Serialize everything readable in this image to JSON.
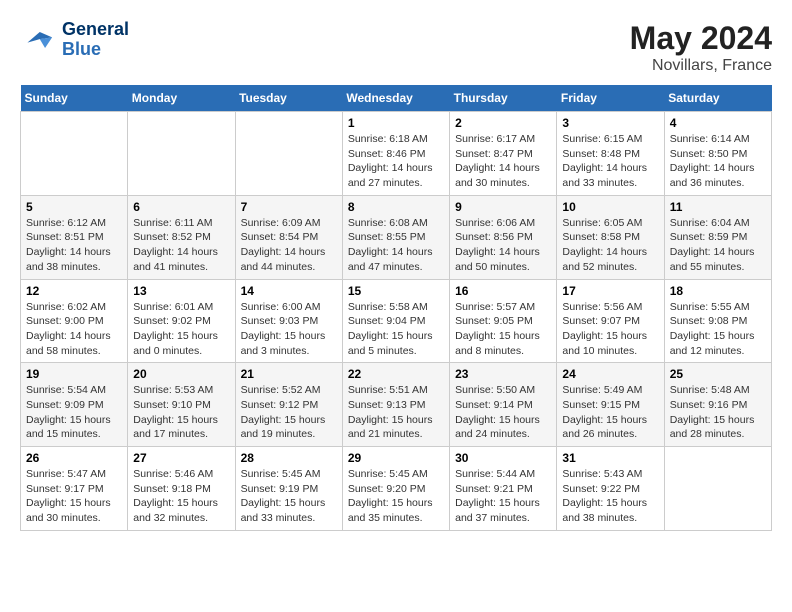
{
  "logo": {
    "text_general": "General",
    "text_blue": "Blue"
  },
  "title": "May 2024",
  "subtitle": "Novillars, France",
  "days_header": [
    "Sunday",
    "Monday",
    "Tuesday",
    "Wednesday",
    "Thursday",
    "Friday",
    "Saturday"
  ],
  "weeks": [
    [
      {
        "day": "",
        "info": ""
      },
      {
        "day": "",
        "info": ""
      },
      {
        "day": "",
        "info": ""
      },
      {
        "day": "1",
        "info": "Sunrise: 6:18 AM\nSunset: 8:46 PM\nDaylight: 14 hours and 27 minutes."
      },
      {
        "day": "2",
        "info": "Sunrise: 6:17 AM\nSunset: 8:47 PM\nDaylight: 14 hours and 30 minutes."
      },
      {
        "day": "3",
        "info": "Sunrise: 6:15 AM\nSunset: 8:48 PM\nDaylight: 14 hours and 33 minutes."
      },
      {
        "day": "4",
        "info": "Sunrise: 6:14 AM\nSunset: 8:50 PM\nDaylight: 14 hours and 36 minutes."
      }
    ],
    [
      {
        "day": "5",
        "info": "Sunrise: 6:12 AM\nSunset: 8:51 PM\nDaylight: 14 hours and 38 minutes."
      },
      {
        "day": "6",
        "info": "Sunrise: 6:11 AM\nSunset: 8:52 PM\nDaylight: 14 hours and 41 minutes."
      },
      {
        "day": "7",
        "info": "Sunrise: 6:09 AM\nSunset: 8:54 PM\nDaylight: 14 hours and 44 minutes."
      },
      {
        "day": "8",
        "info": "Sunrise: 6:08 AM\nSunset: 8:55 PM\nDaylight: 14 hours and 47 minutes."
      },
      {
        "day": "9",
        "info": "Sunrise: 6:06 AM\nSunset: 8:56 PM\nDaylight: 14 hours and 50 minutes."
      },
      {
        "day": "10",
        "info": "Sunrise: 6:05 AM\nSunset: 8:58 PM\nDaylight: 14 hours and 52 minutes."
      },
      {
        "day": "11",
        "info": "Sunrise: 6:04 AM\nSunset: 8:59 PM\nDaylight: 14 hours and 55 minutes."
      }
    ],
    [
      {
        "day": "12",
        "info": "Sunrise: 6:02 AM\nSunset: 9:00 PM\nDaylight: 14 hours and 58 minutes."
      },
      {
        "day": "13",
        "info": "Sunrise: 6:01 AM\nSunset: 9:02 PM\nDaylight: 15 hours and 0 minutes."
      },
      {
        "day": "14",
        "info": "Sunrise: 6:00 AM\nSunset: 9:03 PM\nDaylight: 15 hours and 3 minutes."
      },
      {
        "day": "15",
        "info": "Sunrise: 5:58 AM\nSunset: 9:04 PM\nDaylight: 15 hours and 5 minutes."
      },
      {
        "day": "16",
        "info": "Sunrise: 5:57 AM\nSunset: 9:05 PM\nDaylight: 15 hours and 8 minutes."
      },
      {
        "day": "17",
        "info": "Sunrise: 5:56 AM\nSunset: 9:07 PM\nDaylight: 15 hours and 10 minutes."
      },
      {
        "day": "18",
        "info": "Sunrise: 5:55 AM\nSunset: 9:08 PM\nDaylight: 15 hours and 12 minutes."
      }
    ],
    [
      {
        "day": "19",
        "info": "Sunrise: 5:54 AM\nSunset: 9:09 PM\nDaylight: 15 hours and 15 minutes."
      },
      {
        "day": "20",
        "info": "Sunrise: 5:53 AM\nSunset: 9:10 PM\nDaylight: 15 hours and 17 minutes."
      },
      {
        "day": "21",
        "info": "Sunrise: 5:52 AM\nSunset: 9:12 PM\nDaylight: 15 hours and 19 minutes."
      },
      {
        "day": "22",
        "info": "Sunrise: 5:51 AM\nSunset: 9:13 PM\nDaylight: 15 hours and 21 minutes."
      },
      {
        "day": "23",
        "info": "Sunrise: 5:50 AM\nSunset: 9:14 PM\nDaylight: 15 hours and 24 minutes."
      },
      {
        "day": "24",
        "info": "Sunrise: 5:49 AM\nSunset: 9:15 PM\nDaylight: 15 hours and 26 minutes."
      },
      {
        "day": "25",
        "info": "Sunrise: 5:48 AM\nSunset: 9:16 PM\nDaylight: 15 hours and 28 minutes."
      }
    ],
    [
      {
        "day": "26",
        "info": "Sunrise: 5:47 AM\nSunset: 9:17 PM\nDaylight: 15 hours and 30 minutes."
      },
      {
        "day": "27",
        "info": "Sunrise: 5:46 AM\nSunset: 9:18 PM\nDaylight: 15 hours and 32 minutes."
      },
      {
        "day": "28",
        "info": "Sunrise: 5:45 AM\nSunset: 9:19 PM\nDaylight: 15 hours and 33 minutes."
      },
      {
        "day": "29",
        "info": "Sunrise: 5:45 AM\nSunset: 9:20 PM\nDaylight: 15 hours and 35 minutes."
      },
      {
        "day": "30",
        "info": "Sunrise: 5:44 AM\nSunset: 9:21 PM\nDaylight: 15 hours and 37 minutes."
      },
      {
        "day": "31",
        "info": "Sunrise: 5:43 AM\nSunset: 9:22 PM\nDaylight: 15 hours and 38 minutes."
      },
      {
        "day": "",
        "info": ""
      }
    ]
  ]
}
